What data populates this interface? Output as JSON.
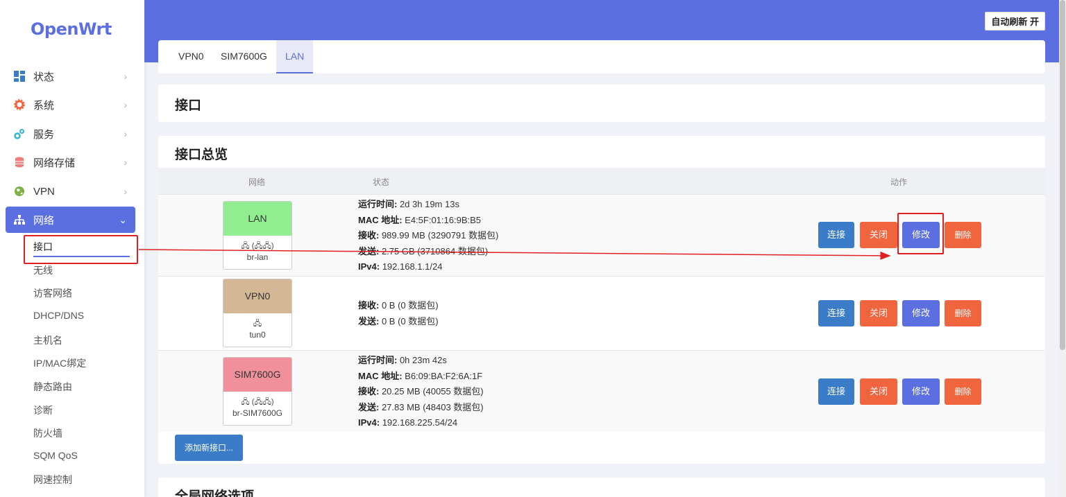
{
  "sidebar": {
    "logo": "OpenWrt",
    "items": [
      {
        "label": "状态",
        "icon": "dashboard-icon",
        "color": "#3a7cc8"
      },
      {
        "label": "系统",
        "icon": "gear-icon",
        "color": "#f0643e"
      },
      {
        "label": "服务",
        "icon": "gears-icon",
        "color": "#36b3d8"
      },
      {
        "label": "网络存储",
        "icon": "database-icon",
        "color": "#f08080"
      },
      {
        "label": "VPN",
        "icon": "globe-icon",
        "color": "#7cb342"
      },
      {
        "label": "网络",
        "icon": "sitemap-icon",
        "color": "#ffffff"
      }
    ],
    "sub_items": [
      "接口",
      "无线",
      "访客网络",
      "DHCP/DNS",
      "主机名",
      "IP/MAC绑定",
      "静态路由",
      "诊断",
      "防火墙",
      "SQM QoS",
      "网速控制"
    ]
  },
  "header": {
    "auto_refresh": "自动刷新 开"
  },
  "tabs": [
    "VPN0",
    "SIM7600G",
    "LAN"
  ],
  "page_title": "接口",
  "overview": {
    "title": "接口总览",
    "columns": [
      "网络",
      "状态",
      "动作"
    ],
    "rows": [
      {
        "name": "LAN",
        "color": "#90ee90",
        "icons": "🖧 (🖧🖧)",
        "device": "br-lan",
        "status": [
          {
            "label": "运行时间:",
            "value": " 2d 3h 19m 13s"
          },
          {
            "label": "MAC 地址:",
            "value": " E4:5F:01:16:9B:B5"
          },
          {
            "label": "接收:",
            "value": " 989.99 MB (3290791 数据包)"
          },
          {
            "label": "发送:",
            "value": " 2.75 GB (3710864 数据包)"
          },
          {
            "label": "IPv4:",
            "value": " 192.168.1.1/24"
          }
        ]
      },
      {
        "name": "VPN0",
        "color": "#d4b896",
        "icons": "🖧",
        "device": "tun0",
        "status": [
          {
            "label": "接收:",
            "value": " 0 B (0 数据包)"
          },
          {
            "label": "发送:",
            "value": " 0 B (0 数据包)"
          }
        ]
      },
      {
        "name": "SIM7600G",
        "color": "#f0909a",
        "icons": "🖧 (🖧🖧)",
        "device": "br-SIM7600G",
        "status": [
          {
            "label": "运行时间:",
            "value": " 0h 23m 42s"
          },
          {
            "label": "MAC 地址:",
            "value": " B6:09:BA:F2:6A:1F"
          },
          {
            "label": "接收:",
            "value": " 20.25 MB (40055 数据包)"
          },
          {
            "label": "发送:",
            "value": " 27.83 MB (48403 数据包)"
          },
          {
            "label": "IPv4:",
            "value": " 192.168.225.54/24"
          }
        ]
      }
    ],
    "actions": {
      "connect": "连接",
      "close": "关闭",
      "edit": "修改",
      "delete": "删除"
    },
    "add_button": "添加新接口..."
  },
  "global_section_title": "全局网络选项"
}
